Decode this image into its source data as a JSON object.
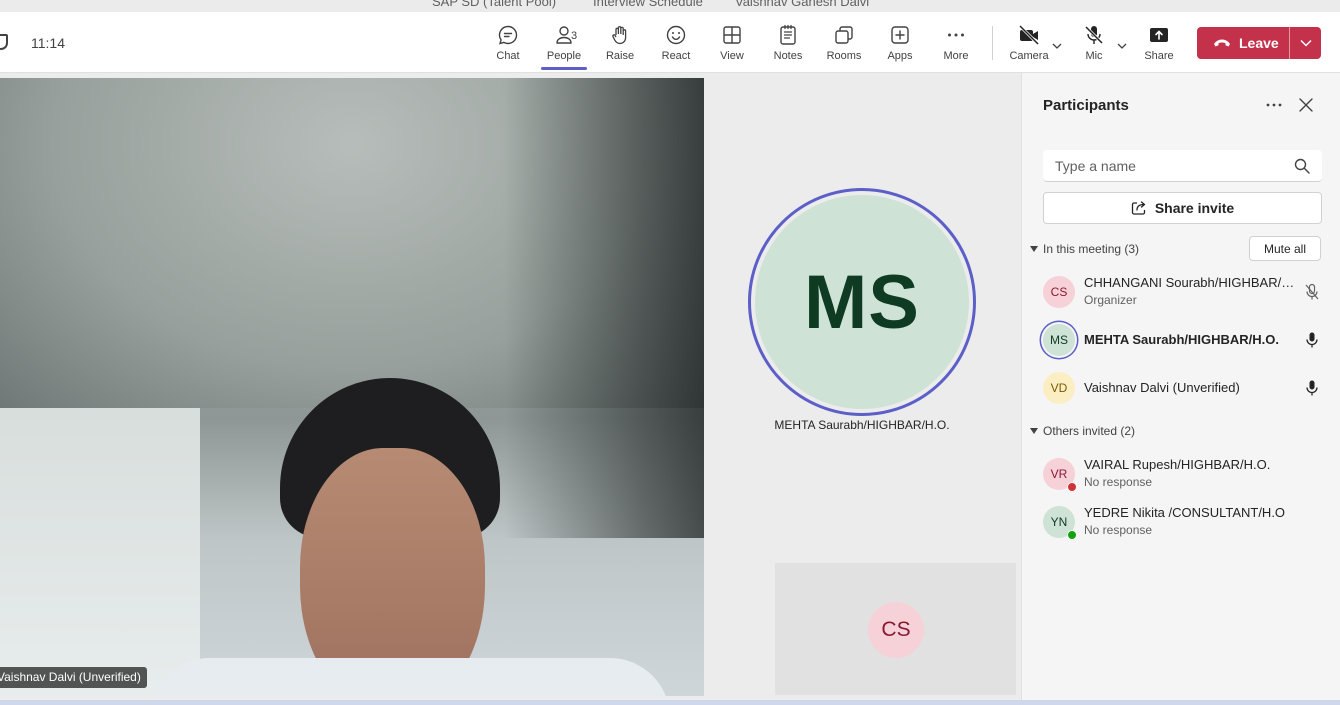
{
  "window": {
    "title_parts": [
      "SAP SD (Talent Pool)",
      "Interview Schedule",
      "Vaishnav Ganesh Dalvi"
    ]
  },
  "toolbar": {
    "time": "11:14",
    "buttons": {
      "chat": "Chat",
      "people": "People",
      "people_count": "3",
      "raise": "Raise",
      "react": "React",
      "view": "View",
      "notes": "Notes",
      "rooms": "Rooms",
      "apps": "Apps",
      "more": "More",
      "camera": "Camera",
      "mic": "Mic",
      "share": "Share"
    },
    "leave_label": "Leave",
    "colors": {
      "accent": "#5b5fc7",
      "leave": "#c4314b"
    }
  },
  "stage": {
    "main_video_name": "Vaishnav Dalvi (Unverified)",
    "speaker_initials": "MS",
    "speaker_name": "MEHTA Saurabh/HIGHBAR/H.O.",
    "small_tile_initials": "CS"
  },
  "panel": {
    "title": "Participants",
    "search_placeholder": "Type a name",
    "share_invite": "Share invite",
    "in_meeting_label": "In this meeting (3)",
    "mute_all": "Mute all",
    "in_meeting": [
      {
        "initials": "CS",
        "name": "CHHANGANI Sourabh/HIGHBAR/H.O.",
        "role": "Organizer",
        "mic": "muted"
      },
      {
        "initials": "MS",
        "name": "MEHTA Saurabh/HIGHBAR/H.O.",
        "role": "",
        "mic": "on"
      },
      {
        "initials": "VD",
        "name": "Vaishnav Dalvi (Unverified)",
        "role": "",
        "mic": "on"
      }
    ],
    "others_label": "Others invited (2)",
    "others": [
      {
        "initials": "VR",
        "name": "VAIRAL Rupesh/HIGHBAR/H.O.",
        "status": "No response",
        "presence": "busy"
      },
      {
        "initials": "YN",
        "name": "YEDRE Nikita /CONSULTANT/H.O",
        "status": "No response",
        "presence": "available"
      }
    ]
  }
}
